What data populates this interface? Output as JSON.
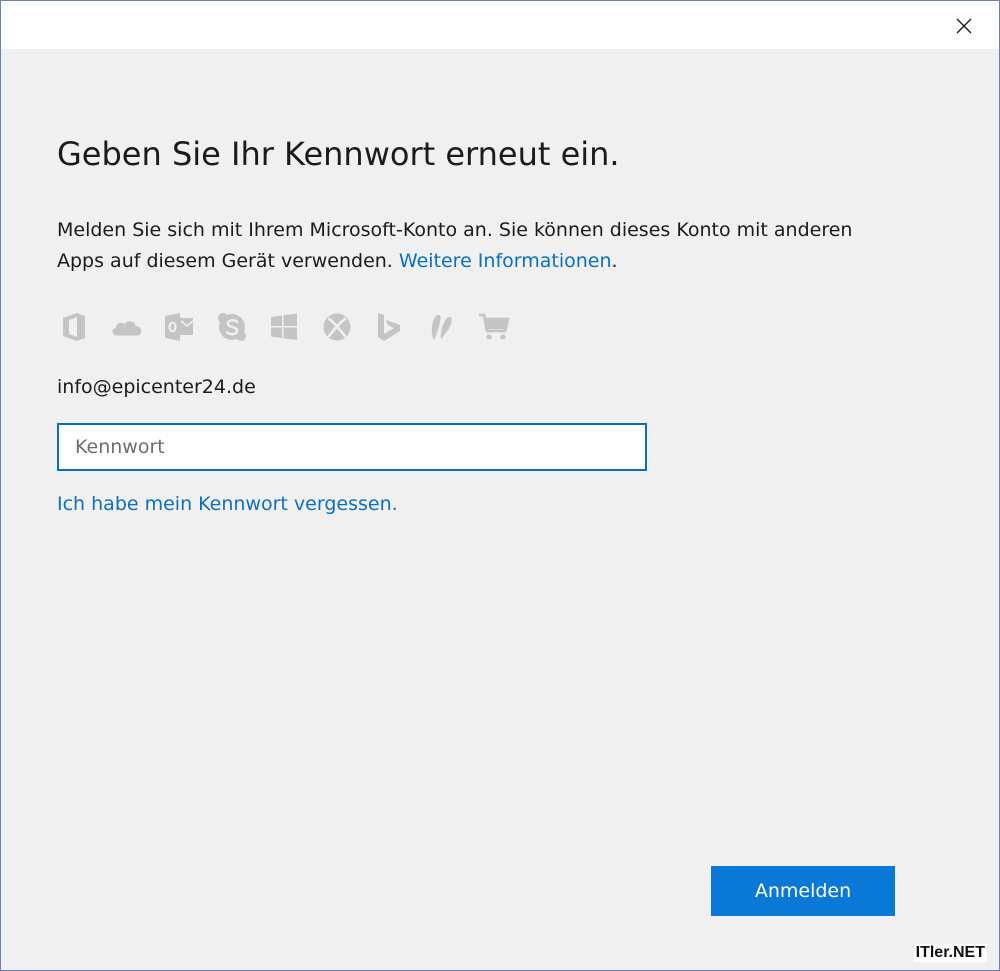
{
  "dialog": {
    "title": "Geben Sie Ihr Kennwort erneut ein.",
    "description": "Melden Sie sich mit Ihrem Microsoft-Konto an. Sie können dieses Konto mit anderen Apps auf diesem Gerät verwenden.",
    "more_info_link": "Weitere Informationen",
    "more_info_suffix": ".",
    "account_email": "info@epicenter24.de",
    "password_placeholder": "Kennwort",
    "password_value": "",
    "forgot_password_link": "Ich habe mein Kennwort vergessen.",
    "signin_button": "Anmelden"
  },
  "app_icons": [
    "office-icon",
    "onedrive-icon",
    "outlook-icon",
    "skype-icon",
    "windows-icon",
    "xbox-icon",
    "bing-icon",
    "msn-icon",
    "store-icon"
  ],
  "watermark": "ITler.NET",
  "colors": {
    "accent": "#0a78d7",
    "link": "#0a6fc2",
    "icon_gray": "#c4c4c4",
    "background": "#f0f0f0"
  }
}
